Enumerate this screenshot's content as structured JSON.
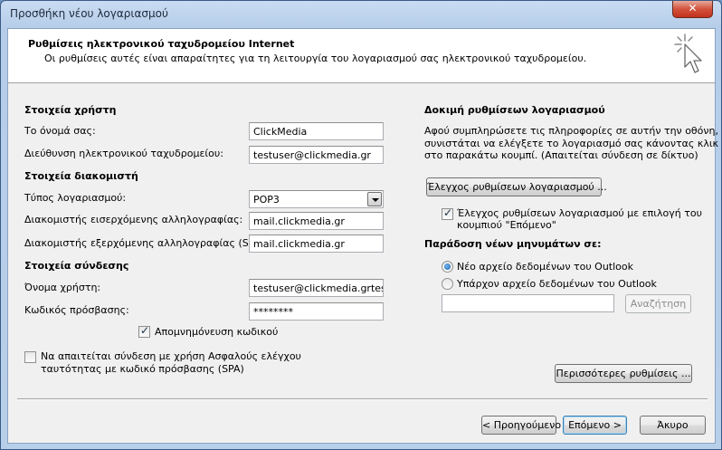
{
  "window": {
    "title": "Προσθήκη νέου λογαριασμού",
    "close_glyph": "✕"
  },
  "header": {
    "title": "Ρυθμίσεις ηλεκτρονικού ταχυδρομείου Internet",
    "subtitle": "Οι ρυθμίσεις αυτές είναι απαραίτητες για τη λειτουργία του λογαριασμού σας ηλεκτρονικού ταχυδρομείου.",
    "icon": "cursor-click-icon"
  },
  "user_info": {
    "heading": "Στοιχεία χρήστη",
    "name_label": "Το όνομά σας:",
    "name_value": "ClickMedia",
    "email_label": "Διεύθυνση ηλεκτρονικού ταχυδρομείου:",
    "email_value": "testuser@clickmedia.gr"
  },
  "server_info": {
    "heading": "Στοιχεία διακομιστή",
    "account_type_label": "Τύπος λογαριασμού:",
    "account_type_value": "POP3",
    "incoming_label": "Διακομιστής εισερχόμενης αλληλογραφίας:",
    "incoming_value": "mail.clickmedia.gr",
    "outgoing_label": "Διακομιστής εξερχόμενης αλληλογραφίας (SMTP):",
    "outgoing_value": "mail.clickmedia.gr"
  },
  "logon_info": {
    "heading": "Στοιχεία σύνδεσης",
    "username_label": "Όνομα χρήστη:",
    "username_value": "testuser@clickmedia.grtestuse",
    "password_label": "Κωδικός πρόσβασης:",
    "password_value": "********",
    "remember_label": "Απομνημόνευση κωδικού",
    "remember_checked": true,
    "spa_label_line1": "Να απαιτείται σύνδεση με χρήση Ασφαλούς ελέγχου",
    "spa_label_line2": "ταυτότητας με κωδικό πρόσβασης (SPA)",
    "spa_checked": false
  },
  "test_settings": {
    "heading": "Δοκιμή ρυθμίσεων λογαριασμού",
    "desc_line1": "Αφού συμπληρώσετε τις πληροφορίες σε αυτήν την οθόνη,",
    "desc_line2": "συνιστάται να ελέγξετε το λογαριασμό σας κάνοντας κλικ",
    "desc_line3": "στο παρακάτω κουμπί. (Απαιτείται σύνδεση σε δίκτυο)",
    "test_button": "Έλεγχος ρυθμίσεων λογαριασμού ...",
    "auto_test_line1": "Έλεγχος ρυθμίσεων λογαριασμού με επιλογή του",
    "auto_test_line2": "κουμπιού \"Επόμενο\"",
    "auto_test_checked": true
  },
  "delivery": {
    "heading": "Παράδοση νέων μηνυμάτων σε:",
    "new_pst_label": "Νέο αρχείο δεδομένων του Outlook",
    "existing_pst_label": "Υπάρχον αρχείο δεδομένων του Outlook",
    "selected": "new",
    "browse_button": "Αναζήτηση"
  },
  "more_settings_button": "Περισσότερες ρυθμίσεις ...",
  "footer": {
    "back_button": "< Προηγούμενο",
    "next_button": "Επόμενο >",
    "cancel_button": "Άκυρο"
  }
}
